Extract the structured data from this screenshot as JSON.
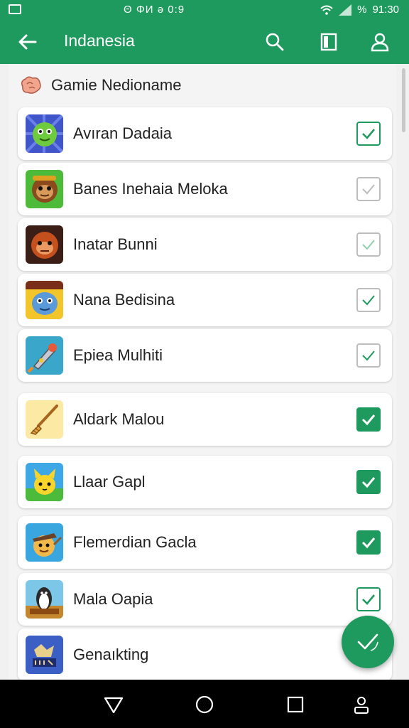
{
  "status_bar": {
    "notifications": "Θ ΦИ ə 0:9",
    "battery": "%",
    "time": "91:30"
  },
  "app_bar": {
    "title": "Indanesia",
    "icons": [
      "back-arrow-icon",
      "search-icon",
      "book-icon",
      "account-icon"
    ]
  },
  "section": {
    "label": "Gamie Nedioname",
    "icon": "brain-icon"
  },
  "games": [
    {
      "name": "Avıran Dadaia",
      "icon": "green-alien-icon",
      "state": "outlined"
    },
    {
      "name": "Banes Inehaia Meloka",
      "icon": "monkey-icon",
      "state": "unchecked"
    },
    {
      "name": "Inatar Bunni",
      "icon": "ape-icon",
      "state": "unchecked"
    },
    {
      "name": "Nana Bedisina",
      "icon": "blue-creature-icon",
      "state": "unchecked"
    },
    {
      "name": "Epiea Mulhiti",
      "icon": "rocket-icon",
      "state": "unchecked"
    },
    {
      "name": "Aldark Malou",
      "icon": "broom-icon",
      "state": "checked"
    },
    {
      "name": "Llaar Gapl",
      "icon": "yellow-creature-icon",
      "state": "checked"
    },
    {
      "name": "Flemerdian Gacla",
      "icon": "hatted-character-icon",
      "state": "checked"
    },
    {
      "name": "Mala Oapia",
      "icon": "penguin-icon",
      "state": "outlined"
    },
    {
      "name": "Genaıkting",
      "icon": "bat-logo-icon",
      "state": "none"
    }
  ],
  "fab": {
    "icon": "check-icon"
  },
  "nav_bar": {
    "icons": [
      "back-triangle-icon",
      "home-circle-icon",
      "recents-square-icon",
      "person-icon"
    ]
  },
  "colors": {
    "primary": "#1f9a5e",
    "background": "#f1f1f1"
  }
}
